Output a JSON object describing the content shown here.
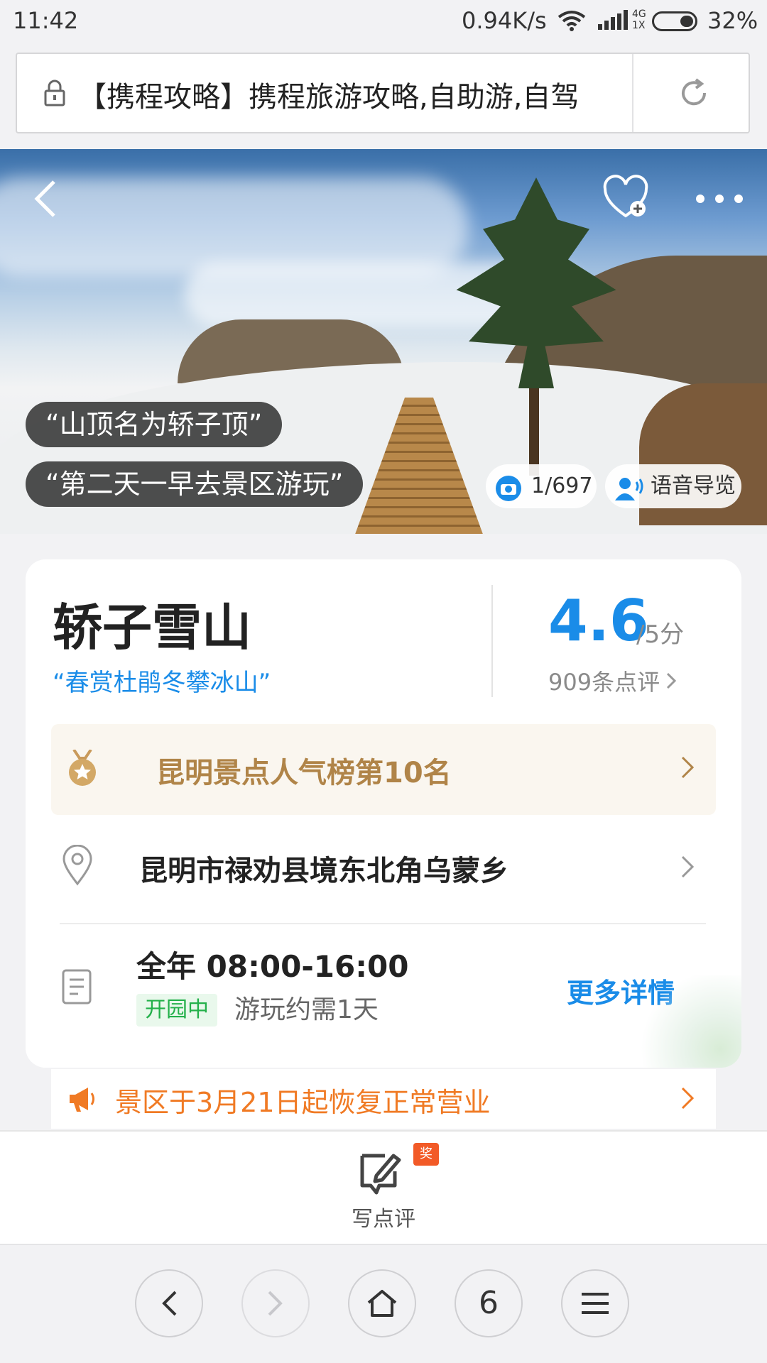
{
  "status_bar": {
    "time": "11:42",
    "network_speed": "0.94K/s",
    "network_type": "4G\n1X",
    "battery": "32%"
  },
  "address_bar": {
    "url_text": "【携程攻略】携程旅游攻略,自助游,自驾"
  },
  "hero": {
    "quote1": "“山顶名为轿子顶”",
    "quote2": "“第二天一早去景区游玩”",
    "photo_counter": "1/697",
    "audio_guide": "语音导览"
  },
  "attraction": {
    "name": "轿子雪山",
    "slogan": "“春赏杜鹃冬攀冰山”",
    "score": "4.6",
    "score_max": "/5分",
    "reviews": "909条点评",
    "ranking": "昆明景点人气榜第10名",
    "address": "昆明市禄劝县境东北角乌蒙乡",
    "hours": "全年 08:00-16:00",
    "open_status": "开园中",
    "duration": "游玩约需1天",
    "more_details": "更多详情"
  },
  "notice": {
    "text": "景区于3月21日起恢复正常营业"
  },
  "footer": {
    "write_review": "写点评",
    "badge": "奖"
  },
  "browser_nav": {
    "tab_count": "6"
  },
  "colors": {
    "accent_blue": "#1a8ce8",
    "rank_gold": "#b08448",
    "notice_orange": "#f07a24",
    "open_green": "#23b04a"
  }
}
